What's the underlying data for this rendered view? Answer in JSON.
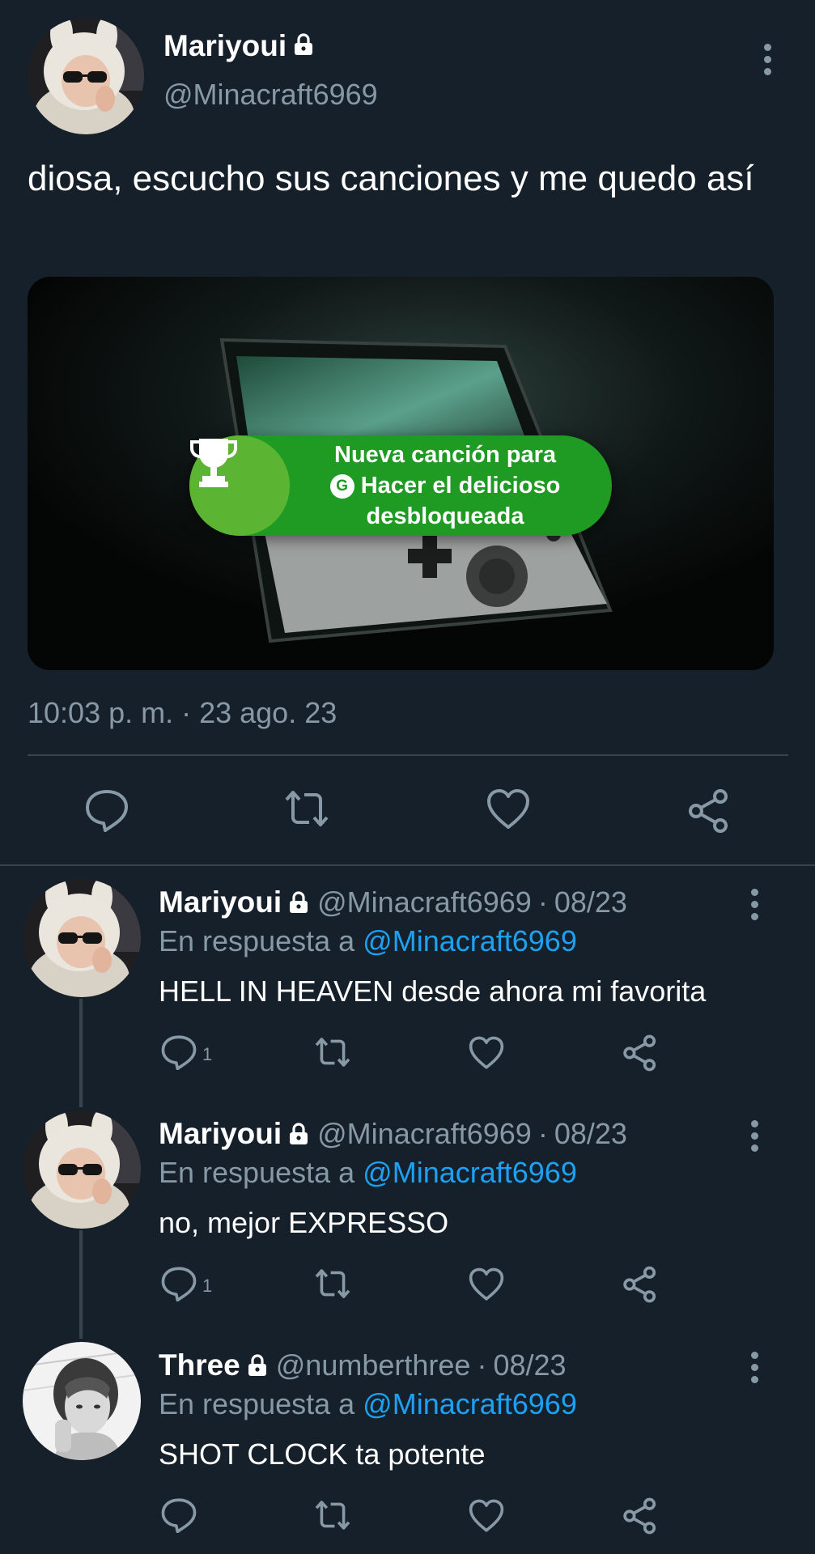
{
  "main_tweet": {
    "display_name": "Mariyoui",
    "handle": "@Minacraft6969",
    "text": "diosa, escucho sus canciones y me quedo así",
    "media": {
      "achievement_line1": "Nueva canción para",
      "achievement_line2": "Hacer el delicioso",
      "achievement_line3": "desbloqueada",
      "badge_letter": "G"
    },
    "timestamp": "10:03 p. m. · 23 ago. 23"
  },
  "replies": [
    {
      "display_name": "Mariyoui",
      "handle": "@Minacraft6969",
      "separator": "·",
      "date": "08/23",
      "reply_prefix": "En respuesta a",
      "mention": "@Minacraft6969",
      "text": "HELL IN HEAVEN desde ahora mi favorita",
      "reply_count": "1"
    },
    {
      "display_name": "Mariyoui",
      "handle": "@Minacraft6969",
      "separator": "·",
      "date": "08/23",
      "reply_prefix": "En respuesta a",
      "mention": "@Minacraft6969",
      "text": "no, mejor EXPRESSO",
      "reply_count": "1"
    },
    {
      "display_name": "Three",
      "handle": "@numberthree",
      "separator": "·",
      "date": "08/23",
      "reply_prefix": "En respuesta a",
      "mention": "@Minacraft6969",
      "text": "SHOT CLOCK ta potente",
      "reply_count": ""
    }
  ],
  "icons": {
    "lock": "lock-icon",
    "more": "more-vertical-icon",
    "reply": "reply-bubble-icon",
    "retweet": "retweet-icon",
    "like": "heart-icon",
    "share": "share-icon",
    "trophy": "trophy-icon"
  },
  "colors": {
    "background": "#15202b",
    "divider": "#38444d",
    "secondary_text": "#8899a6",
    "link": "#1da1f2",
    "achievement_green": "#1f9a22"
  }
}
